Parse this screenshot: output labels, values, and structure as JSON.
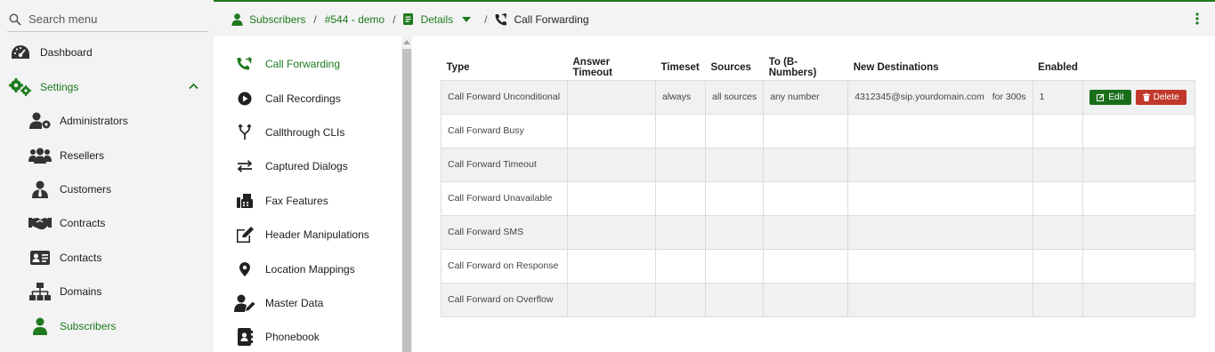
{
  "sidebar": {
    "search_placeholder": "Search menu",
    "items": [
      {
        "label": "Dashboard",
        "icon": "gauge-icon"
      },
      {
        "label": "Settings",
        "icon": "gears-icon"
      },
      {
        "label": "Administrators",
        "icon": "user-gear-icon"
      },
      {
        "label": "Resellers",
        "icon": "users-icon"
      },
      {
        "label": "Customers",
        "icon": "user-tie-icon"
      },
      {
        "label": "Contracts",
        "icon": "handshake-icon"
      },
      {
        "label": "Contacts",
        "icon": "address-card-icon"
      },
      {
        "label": "Domains",
        "icon": "sitemap-icon"
      },
      {
        "label": "Subscribers",
        "icon": "user-icon"
      }
    ]
  },
  "breadcrumb": {
    "subscribers": "Subscribers",
    "subscriber": "#544 - demo",
    "details": "Details",
    "current": "Call Forwarding",
    "separator": "/"
  },
  "details_menu": {
    "items": [
      {
        "label": "Call Forwarding",
        "icon": "phone-forward-icon"
      },
      {
        "label": "Call Recordings",
        "icon": "play-circle-icon"
      },
      {
        "label": "Callthrough CLIs",
        "icon": "branch-icon"
      },
      {
        "label": "Captured Dialogs",
        "icon": "swap-arrows-icon"
      },
      {
        "label": "Fax Features",
        "icon": "fax-icon"
      },
      {
        "label": "Header Manipulations",
        "icon": "edit-icon"
      },
      {
        "label": "Location Mappings",
        "icon": "map-marker-icon"
      },
      {
        "label": "Master Data",
        "icon": "user-edit-icon"
      },
      {
        "label": "Phonebook",
        "icon": "contact-book-icon"
      }
    ]
  },
  "table": {
    "headers": [
      "Type",
      "Answer Timeout",
      "Timeset",
      "Sources",
      "To (B-Numbers)",
      "New Destinations",
      "Enabled",
      ""
    ],
    "rows": [
      {
        "type": "Call Forward Unconditional",
        "answer_timeout": "",
        "timeset": "always",
        "sources": "all sources",
        "to": "any number",
        "destination": "4312345@sip.yourdomain.com",
        "for": "for 300s",
        "enabled": "1"
      },
      {
        "type": "Call Forward Busy",
        "answer_timeout": "",
        "timeset": "",
        "sources": "",
        "to": "",
        "destination": "",
        "for": "",
        "enabled": ""
      },
      {
        "type": "Call Forward Timeout",
        "answer_timeout": "",
        "timeset": "",
        "sources": "",
        "to": "",
        "destination": "",
        "for": "",
        "enabled": ""
      },
      {
        "type": "Call Forward Unavailable",
        "answer_timeout": "",
        "timeset": "",
        "sources": "",
        "to": "",
        "destination": "",
        "for": "",
        "enabled": ""
      },
      {
        "type": "Call Forward SMS",
        "answer_timeout": "",
        "timeset": "",
        "sources": "",
        "to": "",
        "destination": "",
        "for": "",
        "enabled": ""
      },
      {
        "type": "Call Forward on Response",
        "answer_timeout": "",
        "timeset": "",
        "sources": "",
        "to": "",
        "destination": "",
        "for": "",
        "enabled": ""
      },
      {
        "type": "Call Forward on Overflow",
        "answer_timeout": "",
        "timeset": "",
        "sources": "",
        "to": "",
        "destination": "",
        "for": "",
        "enabled": ""
      }
    ],
    "actions": {
      "edit": "Edit",
      "delete": "Delete"
    }
  },
  "colors": {
    "accent": "#1e7a1e",
    "danger": "#c0392b",
    "edit": "#1a6e1a"
  }
}
